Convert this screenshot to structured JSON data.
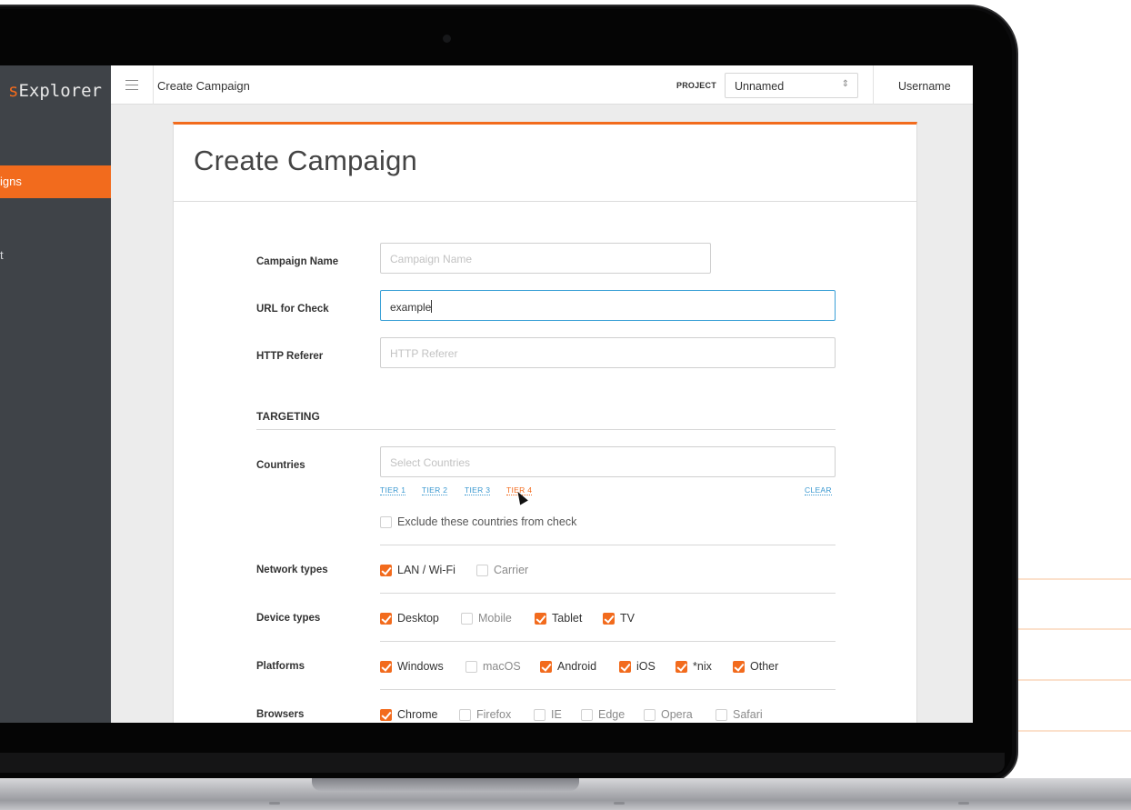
{
  "app": {
    "brand_prefix": "s",
    "brand_suffix": "Explorer",
    "sidebar_items": [
      "igns",
      "t"
    ]
  },
  "topbar": {
    "title": "Create Campaign",
    "project_label": "PROJECT",
    "project_value": "Unnamed",
    "username": "Username"
  },
  "form": {
    "title": "Create Campaign",
    "campaign_name": {
      "label": "Campaign Name",
      "value": "",
      "placeholder": "Campaign Name"
    },
    "url_check": {
      "label": "URL for Check",
      "value": "example"
    },
    "http_referer": {
      "label": "HTTP Referer",
      "value": "",
      "placeholder": "HTTP Referer"
    },
    "targeting_heading": "TARGETING",
    "countries": {
      "label": "Countries",
      "placeholder": "Select Countries",
      "tiers": [
        "TIER 1",
        "TIER 2",
        "TIER 3",
        "TIER 4"
      ],
      "clear": "CLEAR",
      "exclude_label": "Exclude these countries from check",
      "exclude_checked": false
    },
    "network_types": {
      "label": "Network types",
      "options": [
        {
          "label": "LAN / Wi-Fi",
          "checked": true
        },
        {
          "label": "Carrier",
          "checked": false
        }
      ]
    },
    "device_types": {
      "label": "Device types",
      "options": [
        {
          "label": "Desktop",
          "checked": true
        },
        {
          "label": "Mobile",
          "checked": false
        },
        {
          "label": "Tablet",
          "checked": true
        },
        {
          "label": "TV",
          "checked": true
        }
      ]
    },
    "platforms": {
      "label": "Platforms",
      "options": [
        {
          "label": "Windows",
          "checked": true
        },
        {
          "label": "macOS",
          "checked": false
        },
        {
          "label": "Android",
          "checked": true
        },
        {
          "label": "iOS",
          "checked": true
        },
        {
          "label": "*nix",
          "checked": true
        },
        {
          "label": "Other",
          "checked": true
        }
      ]
    },
    "browsers": {
      "label": "Browsers",
      "options": [
        {
          "label": "Chrome",
          "checked": true
        },
        {
          "label": "Firefox",
          "checked": false
        },
        {
          "label": "IE",
          "checked": false
        },
        {
          "label": "Edge",
          "checked": false
        },
        {
          "label": "Opera",
          "checked": false
        },
        {
          "label": "Safari",
          "checked": false
        }
      ]
    }
  },
  "colors": {
    "accent": "#f26b1d",
    "sidebar": "#3f4348",
    "link": "#3a98d0",
    "focus": "#3aa0d6"
  },
  "icons": [
    "menu-icon",
    "select-arrows-icon",
    "checkbox-check-icon",
    "mouse-cursor-icon"
  ]
}
